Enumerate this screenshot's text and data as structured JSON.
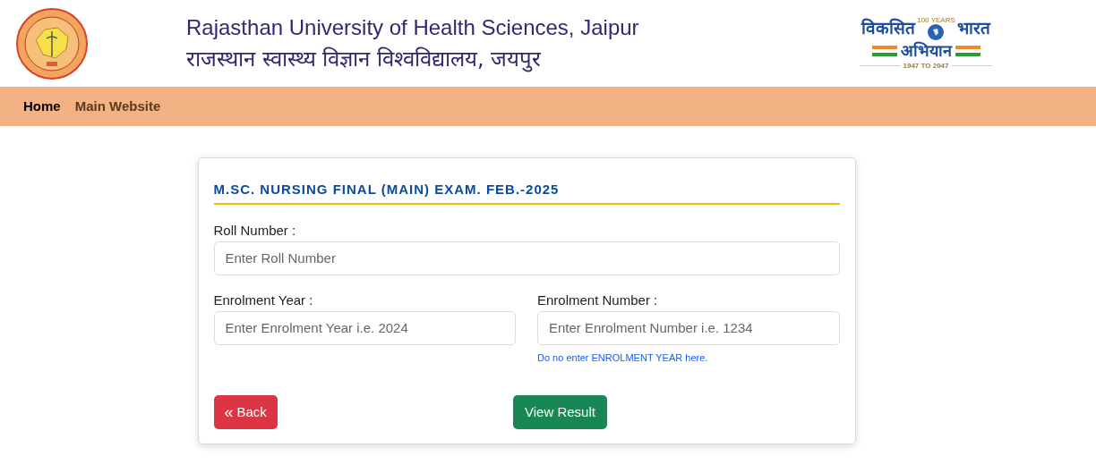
{
  "header": {
    "title_en": "Rajasthan University of Health Sciences, Jaipur",
    "title_hi": "राजस्थान स्वास्थ्य विज्ञान विश्वविद्यालय, जयपुर",
    "campaign_logo": {
      "badge": "100 YEARS",
      "word_1": "विकसित",
      "word_2": "भारत",
      "word_3": "अभियान",
      "years": "1947 TO 2047"
    }
  },
  "nav": [
    {
      "label": "Home",
      "selected": true
    },
    {
      "label": "Main Website",
      "selected": false
    }
  ],
  "form": {
    "title": "M.SC. NURSING FINAL (MAIN) EXAM. FEB.-2025",
    "roll": {
      "label": "Roll Number :",
      "placeholder": "Enter Roll Number"
    },
    "year": {
      "label": "Enrolment Year :",
      "placeholder": "Enter Enrolment Year i.e. 2024"
    },
    "number": {
      "label": "Enrolment Number :",
      "placeholder": "Enter Enrolment Number i.e. 1234",
      "hint": "Do no enter ENROLMENT YEAR here."
    },
    "back_button": {
      "icon": "«",
      "label": "Back"
    },
    "submit_button": "View Result"
  }
}
